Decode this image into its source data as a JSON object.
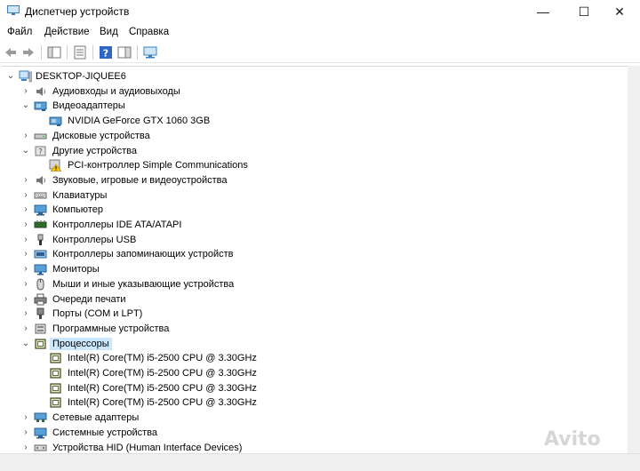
{
  "window": {
    "title": "Диспетчер устройств",
    "minimize": "—",
    "maximize": "☐",
    "close": "✕"
  },
  "menu": [
    "Файл",
    "Действие",
    "Вид",
    "Справка"
  ],
  "tree": {
    "root": "DESKTOP-JIQUEE6",
    "items": [
      {
        "label": "Аудиовходы и аудиовыходы",
        "icon": "speaker-icon",
        "expanded": false
      },
      {
        "label": "Видеоадаптеры",
        "icon": "display-adapter-icon",
        "expanded": true
      },
      {
        "label": "NVIDIA GeForce GTX 1060 3GB",
        "icon": "display-adapter-icon",
        "child": true
      },
      {
        "label": "Дисковые устройства",
        "icon": "disk-drive-icon",
        "expanded": false
      },
      {
        "label": "Другие устройства",
        "icon": "unknown-device-icon",
        "expanded": true
      },
      {
        "label": "PCI-контроллер Simple Communications",
        "icon": "warning-device-icon",
        "child": true
      },
      {
        "label": "Звуковые, игровые и видеоустройства",
        "icon": "speaker-icon",
        "expanded": false
      },
      {
        "label": "Клавиатуры",
        "icon": "keyboard-icon",
        "expanded": false
      },
      {
        "label": "Компьютер",
        "icon": "computer-icon",
        "expanded": false
      },
      {
        "label": "Контроллеры IDE ATA/ATAPI",
        "icon": "ide-controller-icon",
        "expanded": false
      },
      {
        "label": "Контроллеры USB",
        "icon": "usb-icon",
        "expanded": false
      },
      {
        "label": "Контроллеры запоминающих устройств",
        "icon": "storage-controller-icon",
        "expanded": false
      },
      {
        "label": "Мониторы",
        "icon": "monitor-icon",
        "expanded": false
      },
      {
        "label": "Мыши и иные указывающие устройства",
        "icon": "mouse-icon",
        "expanded": false
      },
      {
        "label": "Очереди печати",
        "icon": "printer-icon",
        "expanded": false
      },
      {
        "label": "Порты (COM и LPT)",
        "icon": "port-icon",
        "expanded": false
      },
      {
        "label": "Программные устройства",
        "icon": "software-device-icon",
        "expanded": false
      },
      {
        "label": "Процессоры",
        "icon": "processor-icon",
        "expanded": true,
        "selected": true
      },
      {
        "label": "Intel(R) Core(TM) i5-2500 CPU @ 3.30GHz",
        "icon": "processor-icon",
        "child": true
      },
      {
        "label": "Intel(R) Core(TM) i5-2500 CPU @ 3.30GHz",
        "icon": "processor-icon",
        "child": true
      },
      {
        "label": "Intel(R) Core(TM) i5-2500 CPU @ 3.30GHz",
        "icon": "processor-icon",
        "child": true
      },
      {
        "label": "Intel(R) Core(TM) i5-2500 CPU @ 3.30GHz",
        "icon": "processor-icon",
        "child": true
      },
      {
        "label": "Сетевые адаптеры",
        "icon": "network-adapter-icon",
        "expanded": false
      },
      {
        "label": "Системные устройства",
        "icon": "system-device-icon",
        "expanded": false
      },
      {
        "label": "Устройства HID (Human Interface Devices)",
        "icon": "hid-icon",
        "expanded": false
      }
    ]
  },
  "watermark": "Avito",
  "colors": {
    "selection": "#cce8ff",
    "accent": "#0078d7"
  }
}
